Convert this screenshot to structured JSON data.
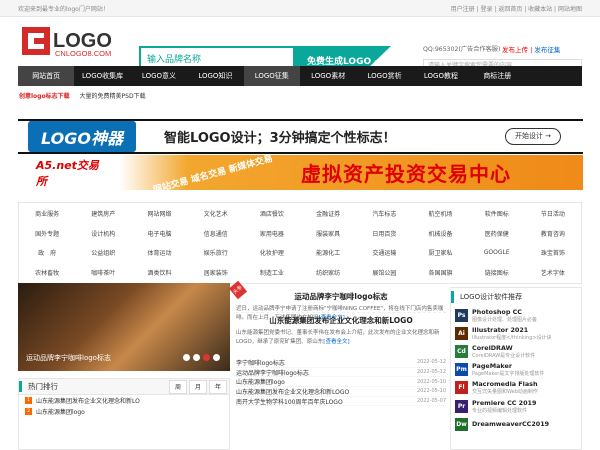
{
  "topbar": {
    "welcome": "欢迎来到最专业的logo门户网站！",
    "links": "用户注册 | 登录 | 返回首页 | 收藏本站 | 网站地图"
  },
  "header": {
    "logo_text": "LOGO",
    "logo_sub": "CNLOGO8.COM",
    "search_placeholder": "输入品牌名称",
    "search_button": "免费生成LOGO ⟶",
    "qq": "QQ:965302(广告合作客服)",
    "upload": "发布上传",
    "publish": "发布征集",
    "search2_placeholder": "请输入关键字搜索您需要的内容"
  },
  "nav": [
    "网站首页",
    "LOGO收集库",
    "LOGO意义",
    "LOGO知识",
    "LOGO征集",
    "LOGO素材",
    "LOGO赏析",
    "LOGO教程",
    "商标注册"
  ],
  "sub": {
    "red": "创意logo标志下载",
    "text": "大量的免费精美PSD下载"
  },
  "banner1": {
    "logo": "LOGO神器",
    "text": "智能LOGO设计；3分钟搞定个性标志！",
    "button": "开始设计 →"
  },
  "banner2": {
    "logo": "A5.net交易所",
    "mid": "网站交易 域名交易 新媒体交易",
    "big": "虚拟资产投资交易中心"
  },
  "categories": [
    [
      "商业服务",
      "建筑房产",
      "网站网络",
      "文化艺术",
      "酒店餐饮",
      "金融证券",
      "汽车标志",
      "航空机场",
      "软件图标",
      "节日活动"
    ],
    [
      "国外专题",
      "设计机构",
      "电子电脑",
      "信息通信",
      "家用电器",
      "服装家具",
      "日用百货",
      "机械设备",
      "医药保健",
      "教育咨询"
    ],
    [
      "政　府",
      "公益组织",
      "体育运动",
      "娱乐旅行",
      "化妆护理",
      "能源化工",
      "交通运输",
      "厨卫家私",
      "GOOGLE",
      "珠宝首饰"
    ],
    [
      "农林畜牧",
      "咖啡茶叶",
      "酒类饮料",
      "居家装饰",
      "制造工业",
      "纺织家纺",
      "展馆公园",
      "各国国旗",
      "链接图标",
      "艺术字体"
    ]
  ],
  "news": {
    "caption": "运动品牌李宁咖啡logo标志",
    "tag": "头条",
    "a1": {
      "title": "运动品牌李宁咖啡logo标志",
      "body": "近日，运动品牌李宁申请了注册商标\"宁咖啡NING COFFEE\"，将在线下门店内售卖咖啡。而在上月，万达集团也在知识",
      "more": "[查看全文]"
    },
    "a2": {
      "title": "山东能源集团发布企业文化理念和新LOGO",
      "body": "山东能源集团党委书记、董事长李伟在发布会上介绍，此次发布的企业文化理念和新LOGO，继承了原兖矿集团、原山东",
      "more": "[查看全文]"
    },
    "list": [
      {
        "t": "李宁咖啡logo标志",
        "d": "2022-05-12"
      },
      {
        "t": "运动品牌李宁咖啡logo标志",
        "d": "2022-05-12"
      },
      {
        "t": "山东能源集团logo",
        "d": "2022-05-10"
      },
      {
        "t": "山东能源集团发布企业文化理念和新LOGO",
        "d": "2022-05-10"
      },
      {
        "t": "南开大学生物学科100周年百年庆LOGO",
        "d": "2022-05-07"
      },
      {
        "t": "",
        "d": ""
      }
    ]
  },
  "hot": {
    "title": "热门排行",
    "tabs": [
      "周",
      "月",
      "年"
    ],
    "items": [
      "山东能源集团发布企业文化理念和新LO",
      "山东能源集团logo"
    ]
  },
  "software": {
    "title": "LOGO设计软件推荐",
    "items": [
      {
        "name": "Photoshop CC",
        "desc": "图像设计处理、处理图片必备",
        "color": "#1e3a5f",
        "abbr": "Ps"
      },
      {
        "name": "Illustrator 2021",
        "desc": "Illustrator程度</thinking>设计诀",
        "color": "#5a2c00",
        "abbr": "Ai"
      },
      {
        "name": "CorelDRAW",
        "desc": "CorelDRAW是专业设计软件",
        "color": "#2b7a3d",
        "abbr": "Cd"
      },
      {
        "name": "PageMaker",
        "desc": "PageMaker是文字排版处理软件",
        "color": "#0b4aa6",
        "abbr": "Pm"
      },
      {
        "name": "Macromedia Flash",
        "desc": "交互式矢量图和Web动画制作",
        "color": "#c21f1f",
        "abbr": "Fl"
      },
      {
        "name": "Premiere CC 2019",
        "desc": "专业的视频编辑处理软件",
        "color": "#3a1f6e",
        "abbr": "Pr"
      },
      {
        "name": "DreamweaverCC2019",
        "desc": "",
        "color": "#1f6e2b",
        "abbr": "Dw"
      }
    ]
  }
}
